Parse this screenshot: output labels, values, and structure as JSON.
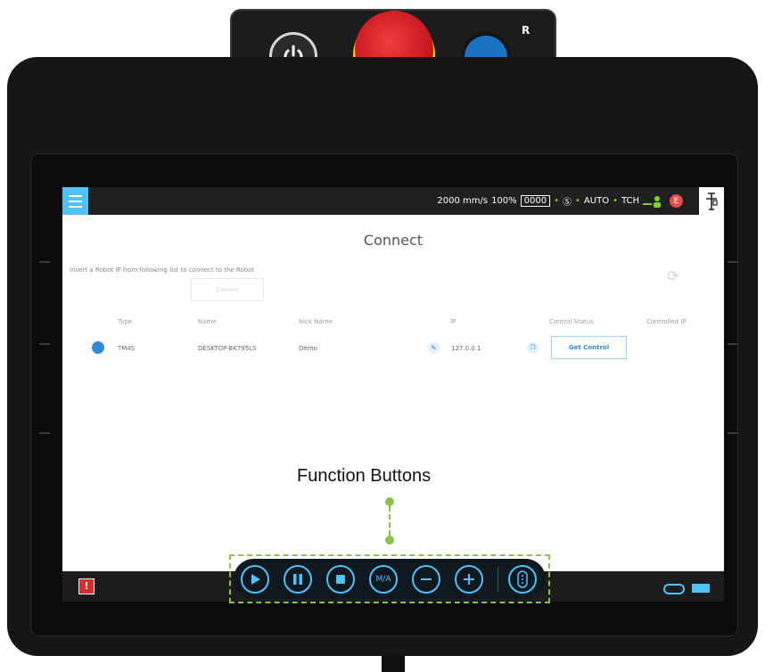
{
  "hardware": {
    "power_icon": "power-icon",
    "emergency_stop": "emergency-stop-button",
    "r_label": "R"
  },
  "topbar": {
    "speed": "2000 mm/s",
    "percent": "100%",
    "mode_code": "0000",
    "auto_label": "AUTO",
    "tch_label": "TCH",
    "e_badge": "E"
  },
  "page": {
    "title": "Connect",
    "instruction": "Insert a Robot IP from following list to connect to the Robot",
    "connect_button": "Connect"
  },
  "table": {
    "columns": [
      "Type",
      "Name",
      "Nick Name",
      "IP",
      "Control Status",
      "Controlled IP"
    ],
    "rows": [
      {
        "type": "TM4S",
        "name": "DESKTOP-BK795LS",
        "nickname": "Demo",
        "ip": "127.0.0.1",
        "control_status": "Get Control",
        "controlled_ip": ""
      }
    ]
  },
  "annotation": {
    "function_buttons_label": "Function Buttons"
  },
  "function_buttons": [
    {
      "name": "play-button",
      "icon": "play-icon"
    },
    {
      "name": "pause-button",
      "icon": "pause-icon"
    },
    {
      "name": "stop-button",
      "icon": "stop-icon"
    },
    {
      "name": "manual-auto-button",
      "icon": "ma-icon",
      "label": "M/A"
    },
    {
      "name": "minus-button",
      "icon": "minus-icon"
    },
    {
      "name": "plus-button",
      "icon": "plus-icon"
    },
    {
      "name": "indicator-button",
      "icon": "indicator-icon"
    }
  ],
  "colors": {
    "accent": "#4fc3f7",
    "status_green": "#7ed321",
    "annotation_green": "#8bc34a",
    "estop_red": "#d81e28",
    "estop_yellow": "#f2d100"
  }
}
